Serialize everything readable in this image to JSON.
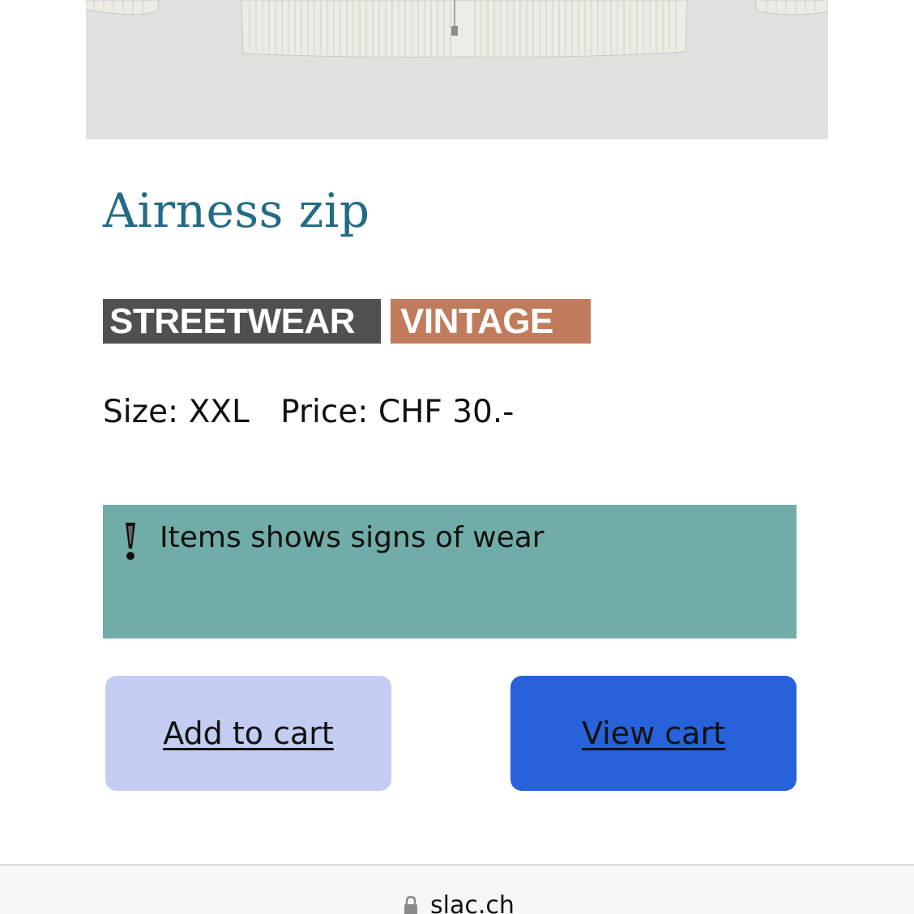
{
  "product": {
    "title": "Airness zip",
    "tags": {
      "streetwear": "STREETWEAR",
      "vintage": "VINTAGE"
    },
    "size": "Size: XXL",
    "price": "Price: CHF 30.-",
    "notice": "Items shows signs of wear"
  },
  "actions": {
    "add_to_cart": "Add to cart",
    "view_cart": "View cart"
  },
  "browser": {
    "domain": "slac.ch"
  },
  "colors": {
    "title": "#236b86",
    "tag_streetwear": "#505050",
    "tag_vintage": "#c07b5c",
    "notice_bg": "#71aca8",
    "add_to_cart_bg": "#c3ccf1",
    "view_cart_bg": "#2762da"
  },
  "icons": {
    "notice": "exclamation-icon",
    "browser": "lock-icon"
  }
}
